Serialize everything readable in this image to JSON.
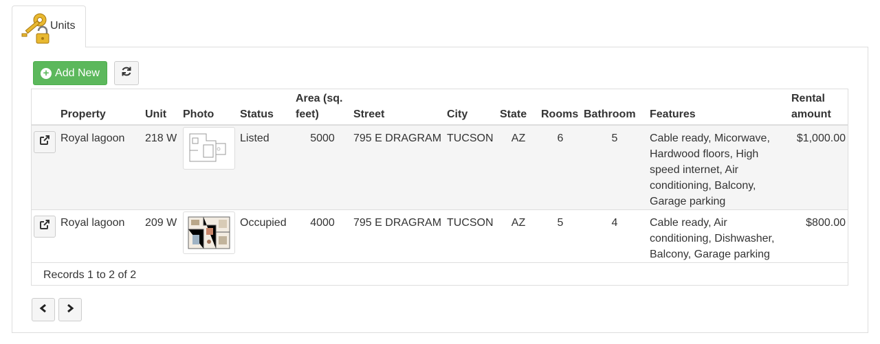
{
  "tab": {
    "label": "Units",
    "icon": "keys-lock-icon"
  },
  "toolbar": {
    "add_label": "Add New",
    "refresh_icon": "refresh-icon"
  },
  "table": {
    "columns": [
      "",
      "Property",
      "Unit",
      "Photo",
      "Status",
      "Area (sq. feet)",
      "Street",
      "City",
      "State",
      "Rooms",
      "Bathroom",
      "Features",
      "Rental amount"
    ],
    "rows": [
      {
        "property": "Royal lagoon",
        "unit": "218 W",
        "photo": "floor-plan-thumbnail",
        "status": "Listed",
        "area": "5000",
        "street": "795 E DRAGRAM",
        "city": "TUCSON",
        "state": "AZ",
        "rooms": "6",
        "bathroom": "5",
        "features": "Cable ready, Micorwave, Hardwood floors, High speed internet, Air conditioning, Balcony, Garage parking",
        "rental": "$1,000.00"
      },
      {
        "property": "Royal lagoon",
        "unit": "209 W",
        "photo": "floor-plan-thumbnail",
        "status": "Occupied",
        "area": "4000",
        "street": "795 E DRAGRAM",
        "city": "TUCSON",
        "state": "AZ",
        "rooms": "5",
        "bathroom": "4",
        "features": "Cable ready, Air conditioning, Dishwasher, Balcony, Garage parking",
        "rental": "$800.00"
      }
    ],
    "footer": "Records 1 to 2 of 2"
  },
  "pager": {
    "prev_icon": "chevron-left-icon",
    "next_icon": "chevron-right-icon"
  },
  "colors": {
    "accent_green": "#5cb85c",
    "border": "#dddddd",
    "row_alt": "#f5f5f5"
  }
}
